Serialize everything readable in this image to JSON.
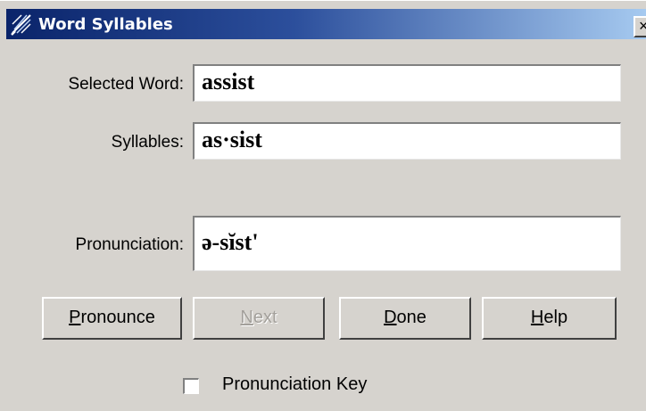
{
  "window": {
    "title": "Word Syllables",
    "close_glyph": "×",
    "app_icon": "feather-lines-icon"
  },
  "fields": {
    "selected_word": {
      "label": "Selected Word:",
      "value": "assist"
    },
    "syllables": {
      "label": "Syllables:",
      "value": "as·sist"
    },
    "pronunciation": {
      "label": "Pronunciation:",
      "value": "ə-sĭst'"
    }
  },
  "buttons": {
    "pronounce": {
      "accel": "P",
      "rest": "ronounce",
      "enabled": true
    },
    "next": {
      "accel": "N",
      "rest": "ext",
      "enabled": false
    },
    "done": {
      "accel": "D",
      "rest": "one",
      "enabled": true
    },
    "help": {
      "accel": "H",
      "rest": "elp",
      "enabled": true
    }
  },
  "checkbox": {
    "label": "Pronunciation Key",
    "checked": false
  },
  "colors": {
    "dialog_bg": "#d6d3ce",
    "title_start": "#0a246a",
    "title_end": "#a6caf0",
    "disabled_text": "#a3a09b"
  }
}
